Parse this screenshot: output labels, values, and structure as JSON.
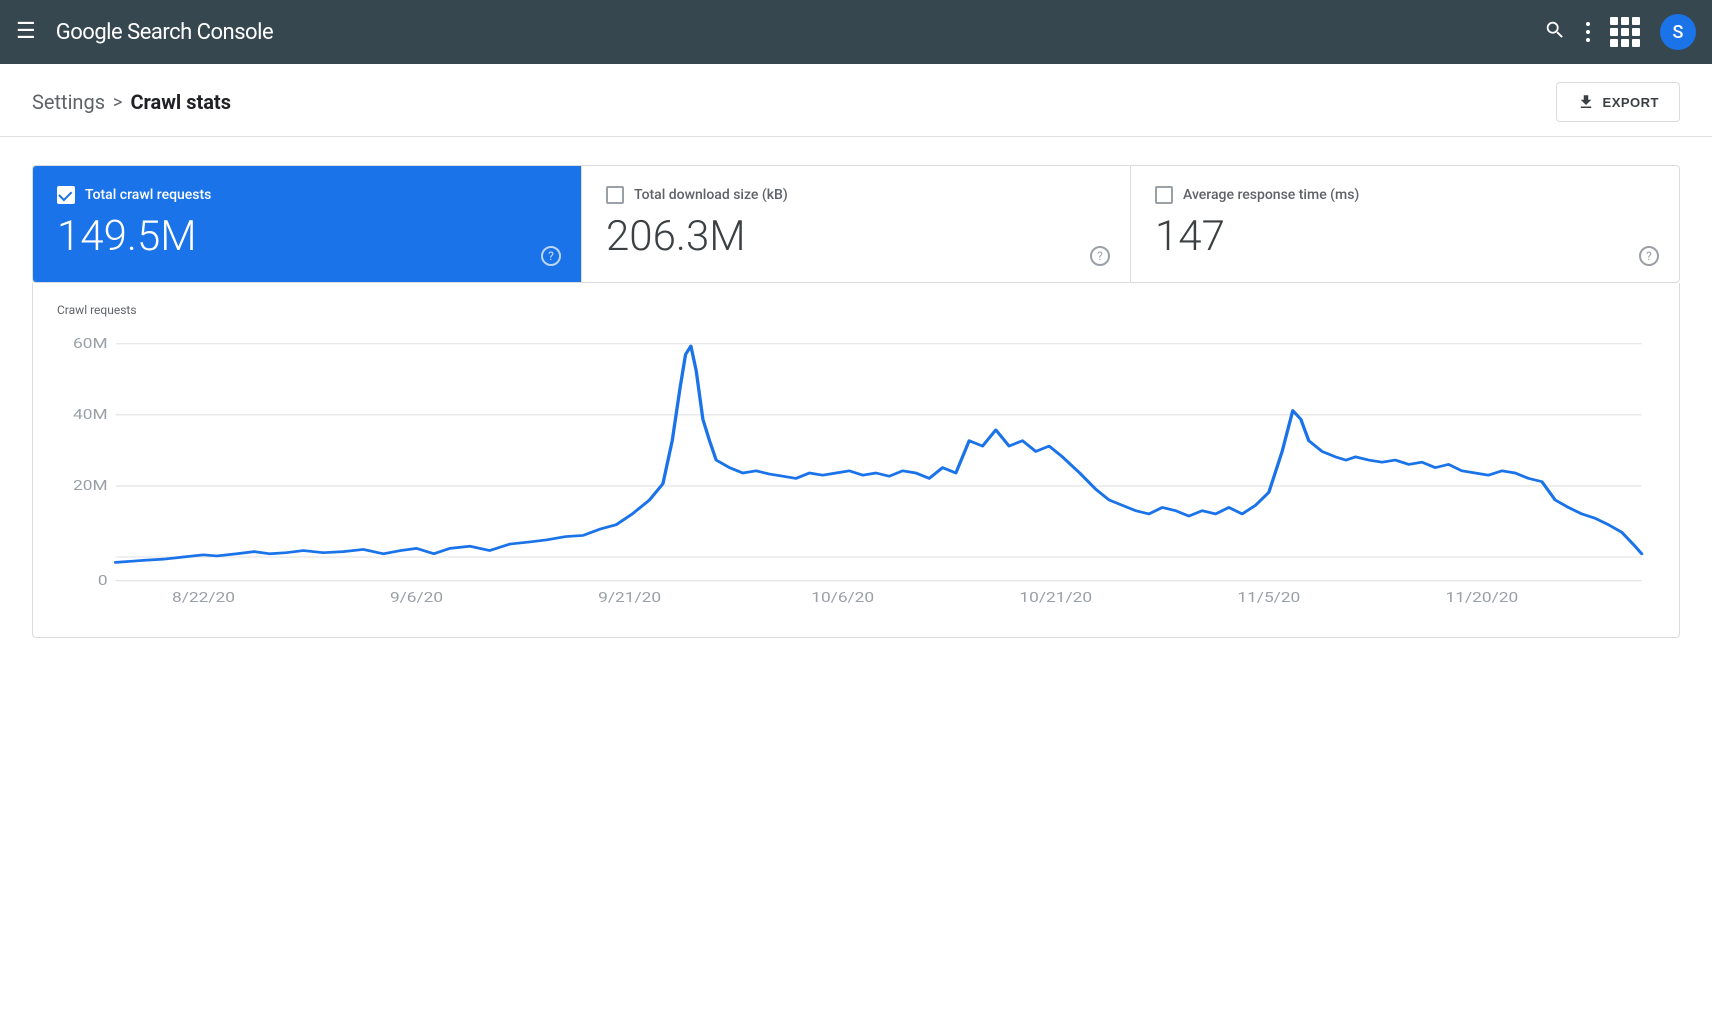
{
  "header": {
    "title": "Google Search Console",
    "title_google": "Google",
    "title_rest": " Search Console",
    "avatar_letter": "S"
  },
  "breadcrumb": {
    "settings_label": "Settings",
    "separator": ">",
    "current_label": "Crawl stats"
  },
  "toolbar": {
    "export_label": "EXPORT"
  },
  "metrics": [
    {
      "id": "total-crawl-requests",
      "label": "Total crawl requests",
      "value": "149.5M",
      "active": true
    },
    {
      "id": "total-download-size",
      "label": "Total download size (kB)",
      "value": "206.3M",
      "active": false
    },
    {
      "id": "avg-response-time",
      "label": "Average response time (ms)",
      "value": "147",
      "active": false
    }
  ],
  "chart": {
    "title": "Crawl requests",
    "y_axis": [
      "60M",
      "40M",
      "20M",
      "0"
    ],
    "x_axis": [
      "8/22/20",
      "9/6/20",
      "9/21/20",
      "10/6/20",
      "10/21/20",
      "11/5/20",
      "11/20/20"
    ]
  }
}
